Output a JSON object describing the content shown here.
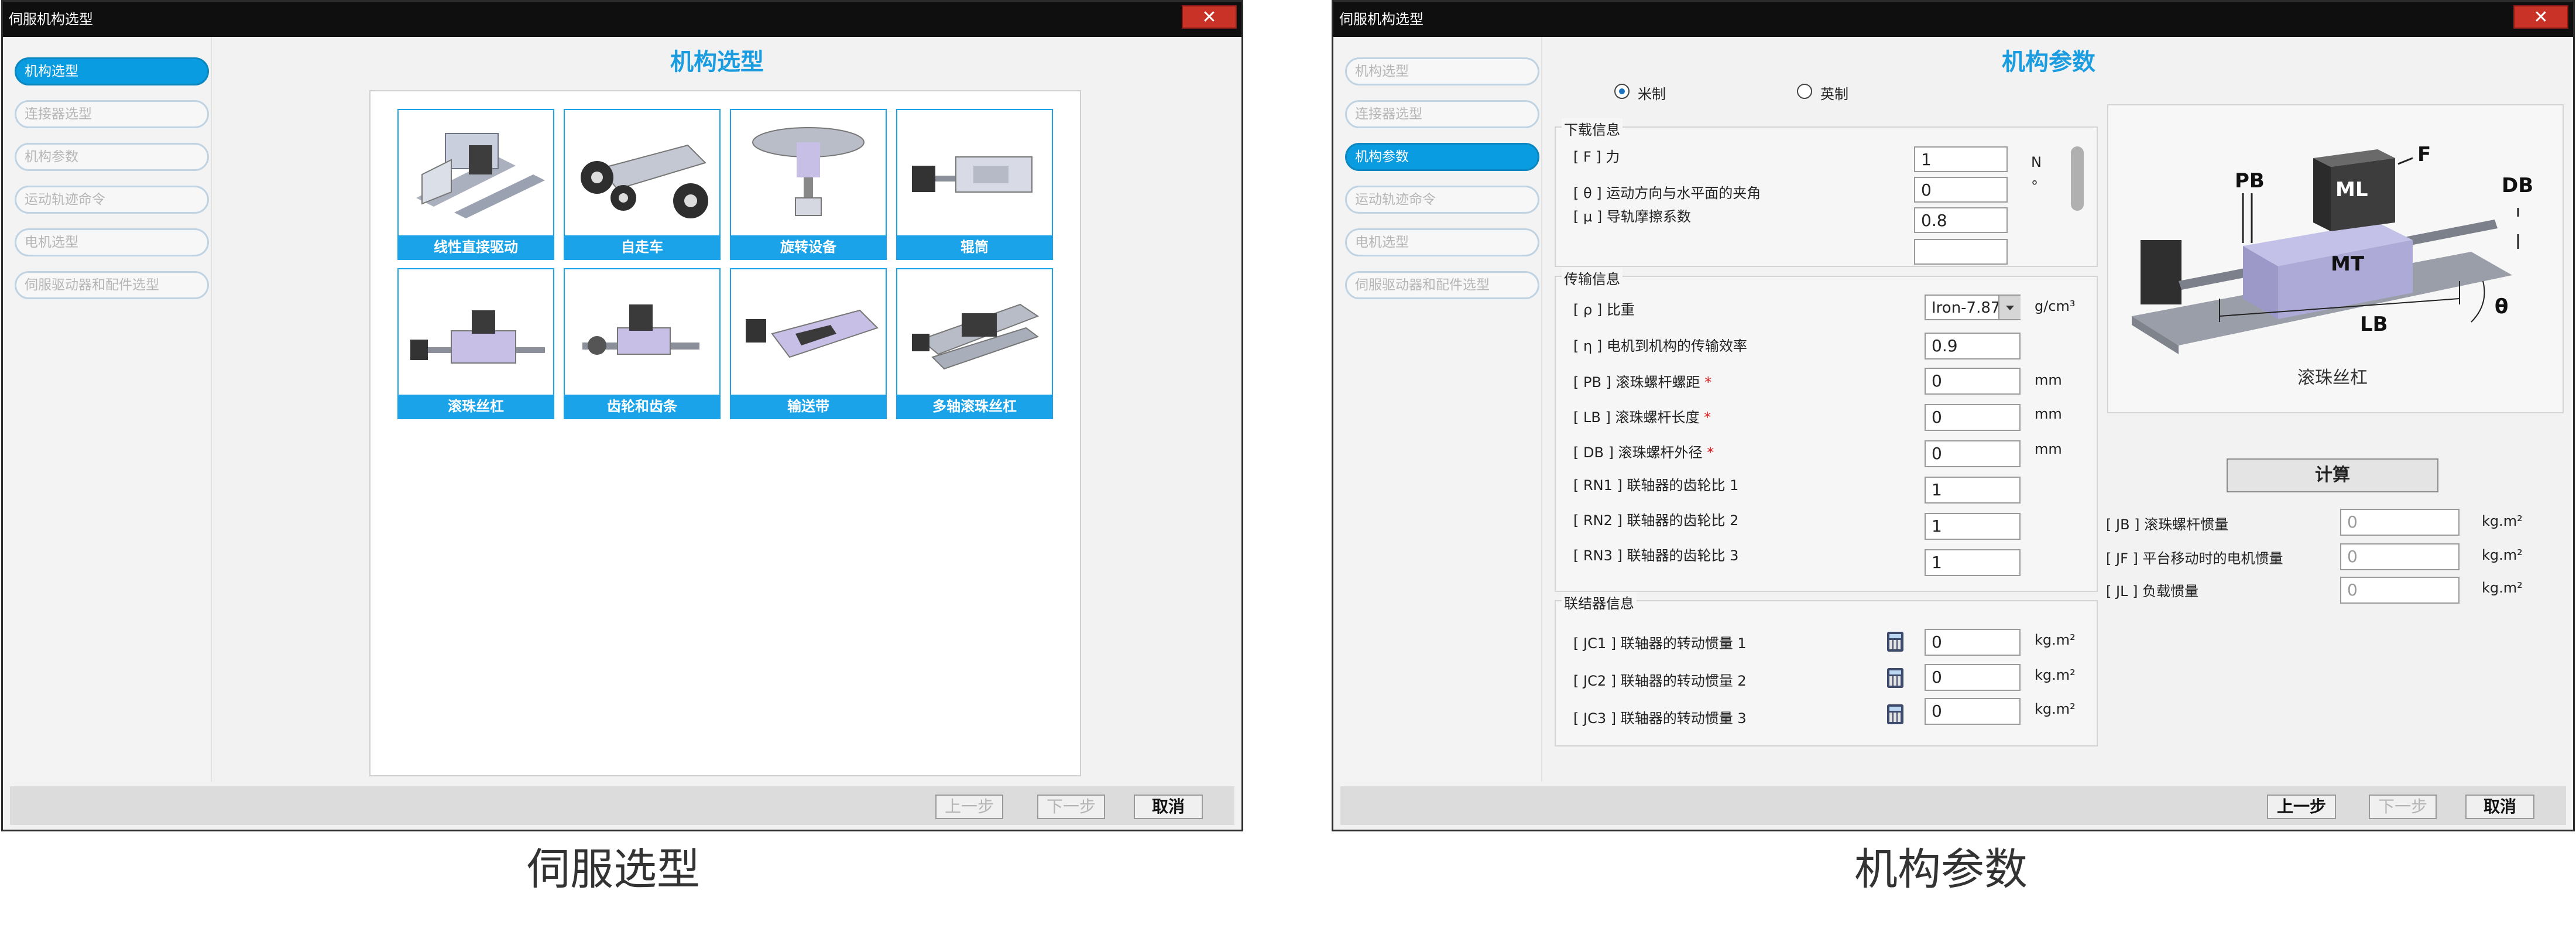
{
  "left_window": {
    "title": "伺服机构选型",
    "close_label": "✕",
    "page_title": "机构选型",
    "nav": [
      "机构选型",
      "连接器选型",
      "机构参数",
      "运动轨迹命令",
      "电机选型",
      "伺服驱动器和配件选型"
    ],
    "active_nav": 0,
    "mechanisms": [
      "线性直接驱动",
      "自走车",
      "旋转设备",
      "辊筒",
      "滚珠丝杠",
      "齿轮和齿条",
      "输送带",
      "多轴滚珠丝杠"
    ],
    "buttons": {
      "prev": "上一步",
      "next": "下一步",
      "cancel": "取消"
    }
  },
  "right_window": {
    "title": "伺服机构选型",
    "close_label": "✕",
    "page_title": "机构参数",
    "nav": [
      "机构选型",
      "连接器选型",
      "机构参数",
      "运动轨迹命令",
      "电机选型",
      "伺服驱动器和配件选型"
    ],
    "active_nav": 2,
    "units": {
      "metric": "米制",
      "imperial": "英制",
      "selected": "metric"
    },
    "load_info": {
      "legend": "下载信息",
      "rows": [
        {
          "symbol": "F",
          "label": "力",
          "value": "1",
          "unit": "N"
        },
        {
          "symbol": "θ",
          "label": "运动方向与水平面的夹角",
          "value": "0",
          "unit": "°"
        },
        {
          "symbol": "μ",
          "label": "导轨摩擦系数",
          "value": "0.8",
          "unit": ""
        }
      ]
    },
    "transmission_info": {
      "legend": "传输信息",
      "density_label": "[ ρ ] 比重",
      "density_value": "Iron-7.87",
      "density_unit": "g/cm³",
      "rows": [
        {
          "label": "[ η ] 电机到机构的传输效率",
          "value": "0.9",
          "unit": "",
          "required": false
        },
        {
          "label": "[ PB ] 滚珠螺杆螺距",
          "value": "0",
          "unit": "mm",
          "required": true
        },
        {
          "label": "[ LB ] 滚珠螺杆长度",
          "value": "0",
          "unit": "mm",
          "required": true
        },
        {
          "label": "[ DB ] 滚珠螺杆外径",
          "value": "0",
          "unit": "mm",
          "required": true
        },
        {
          "label": "[ RN1 ] 联轴器的齿轮比 1",
          "value": "1",
          "unit": "",
          "required": false
        },
        {
          "label": "[ RN2 ] 联轴器的齿轮比 2",
          "value": "1",
          "unit": "",
          "required": false
        },
        {
          "label": "[ RN3 ] 联轴器的齿轮比 3",
          "value": "1",
          "unit": "",
          "required": false
        }
      ]
    },
    "coupling_info": {
      "legend": "联结器信息",
      "rows": [
        {
          "label": "[ JC1 ] 联轴器的转动惯量 1",
          "value": "0",
          "unit": "kg.m²"
        },
        {
          "label": "[ JC2 ] 联轴器的转动惯量 2",
          "value": "0",
          "unit": "kg.m²"
        },
        {
          "label": "[ JC3 ] 联轴器的转动惯量 3",
          "value": "0",
          "unit": "kg.m²"
        }
      ]
    },
    "diagram": {
      "caption": "滚珠丝杠",
      "labels": {
        "pb": "PB",
        "ml": "ML",
        "f": "F",
        "db": "DB",
        "mt": "MT",
        "lb": "LB",
        "theta": "θ"
      }
    },
    "calc_label": "计算",
    "results": [
      {
        "label": "[ JB ] 滚珠螺杆惯量",
        "value": "0",
        "unit": "kg.m²"
      },
      {
        "label": "[ JF ] 平台移动时的电机惯量",
        "value": "0",
        "unit": "kg.m²"
      },
      {
        "label": "[ JL ] 负载惯量",
        "value": "0",
        "unit": "kg.m²"
      }
    ],
    "buttons": {
      "prev": "上一步",
      "next": "下一步",
      "cancel": "取消"
    }
  },
  "captions": {
    "left": "伺服选型",
    "right": "机构参数"
  }
}
